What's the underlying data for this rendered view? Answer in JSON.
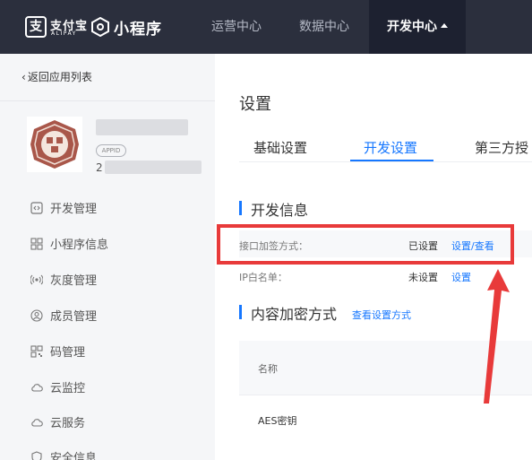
{
  "topnav": {
    "alipay_cn": "支付宝",
    "alipay_en": "ALIPAY",
    "product": "小程序",
    "items": [
      {
        "label": "运营中心"
      },
      {
        "label": "数据中心"
      },
      {
        "label": "开发中心"
      }
    ]
  },
  "sidebar": {
    "back": "返回应用列表",
    "appid_badge": "APPID",
    "appid_visible": "2",
    "items": [
      {
        "label": "开发管理",
        "icon": "code-icon"
      },
      {
        "label": "小程序信息",
        "icon": "grid-icon"
      },
      {
        "label": "灰度管理",
        "icon": "broadcast-icon"
      },
      {
        "label": "成员管理",
        "icon": "user-icon"
      },
      {
        "label": "码管理",
        "icon": "qrcode-icon"
      },
      {
        "label": "云监控",
        "icon": "cloud-icon"
      },
      {
        "label": "云服务",
        "icon": "cloud-icon"
      },
      {
        "label": "安全信息",
        "icon": "shield-icon"
      }
    ]
  },
  "main": {
    "title": "设置",
    "tabs": [
      {
        "label": "基础设置"
      },
      {
        "label": "开发设置"
      },
      {
        "label": "第三方授"
      }
    ],
    "dev_info": {
      "title": "开发信息",
      "rows": [
        {
          "label": "接口加签方式：",
          "status": "已设置",
          "link": "设置/查看"
        },
        {
          "label": "IP白名单：",
          "status": "未设置",
          "link": "设置"
        }
      ]
    },
    "content_enc": {
      "title": "内容加密方式",
      "link": "查看设置方式",
      "table_header": "名称",
      "table_rows": [
        {
          "name": "AES密钥"
        }
      ]
    }
  },
  "colors": {
    "nav_bg": "#2b2f3d",
    "accent": "#1677ff",
    "annotation": "#e83a3a"
  }
}
